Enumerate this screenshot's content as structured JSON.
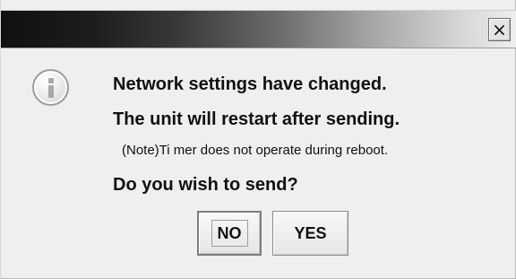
{
  "dialog": {
    "close_glyph": "×",
    "icon": "info-icon",
    "messages": [
      "Network settings have changed.",
      "The unit will restart after sending.",
      "(Note)Ti mer does not operate during reboot.",
      "Do you wish to send?"
    ],
    "buttons": {
      "no": "NO",
      "yes": "YES"
    }
  }
}
